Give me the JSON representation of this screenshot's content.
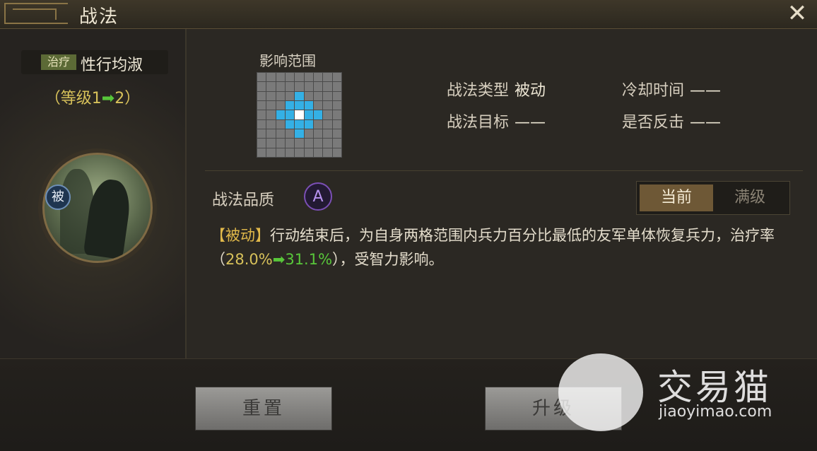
{
  "window": {
    "title": "战法",
    "close_symbol": "✕"
  },
  "skill": {
    "tag": "治疗",
    "name": "性行均淑",
    "level_prefix": "（等级1",
    "level_arrow": "➡",
    "level_suffix": "2）",
    "badge": "被"
  },
  "range": {
    "label": "影响范围",
    "grid_rows": 9,
    "grid_cols": 9,
    "highlight_cells": [
      [
        2,
        4
      ],
      [
        3,
        3
      ],
      [
        3,
        4
      ],
      [
        3,
        5
      ],
      [
        4,
        2
      ],
      [
        4,
        3
      ],
      [
        4,
        5
      ],
      [
        4,
        6
      ],
      [
        5,
        3
      ],
      [
        5,
        4
      ],
      [
        5,
        5
      ],
      [
        6,
        4
      ]
    ],
    "center_cell": [
      4,
      4
    ]
  },
  "info": {
    "type_label": "战法类型",
    "type_value": "被动",
    "cooldown_label": "冷却时间",
    "cooldown_value": "——",
    "target_label": "战法目标",
    "target_value": "——",
    "counter_label": "是否反击",
    "counter_value": "——"
  },
  "quality": {
    "label": "战法品质",
    "grade": "A"
  },
  "toggle": {
    "current": "当前",
    "max": "满级"
  },
  "description": {
    "tag": "【被动】",
    "text1": "行动结束后，为自身两格范围内兵力百分比最低的友军单体恢复兵力，治疗率（",
    "old_value": "28.0%",
    "arrow": "➡",
    "new_value": "31.1%",
    "text2": "），受智力影响。"
  },
  "buttons": {
    "reset": "重置",
    "upgrade": "升级"
  },
  "watermark": {
    "brand": "交易猫",
    "url": "jiaoyimao.com"
  },
  "colors": {
    "grid_highlight": "#34b0e5",
    "quality": "#7b4fb5",
    "level_up": "#58c63a"
  }
}
